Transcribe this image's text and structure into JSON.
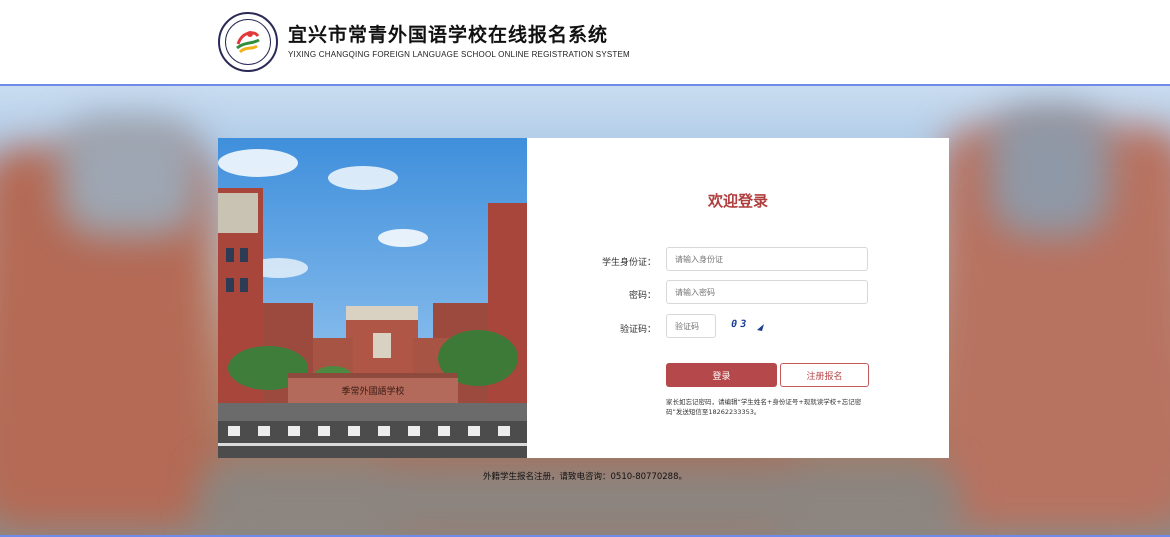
{
  "header": {
    "title_cn": "宜兴市常青外国语学校在线报名系统",
    "title_en": "YIXING CHANGQING FOREIGN LANGUAGE SCHOOL ONLINE REGISTRATION SYSTEM"
  },
  "login": {
    "welcome": "欢迎登录",
    "id_label": "学生身份证：",
    "id_placeholder": "请输入身份证",
    "password_label": "密码：",
    "password_placeholder": "请输入密码",
    "captcha_label": "验证码：",
    "captcha_placeholder": "验证码",
    "captcha_text": "03",
    "login_button": "登录",
    "register_button": "注册报名",
    "note": "家长如忘记密码，请编辑“学生姓名+身份证号+现就读学校+忘记密码”发送短信至18262233353。"
  },
  "school_sign": "季常外國語学校",
  "footer": "外籍学生报名注册，请致电咨询：0510-80770288。",
  "colors": {
    "accent": "#b5484a",
    "border_blue": "#6f8ae8"
  }
}
